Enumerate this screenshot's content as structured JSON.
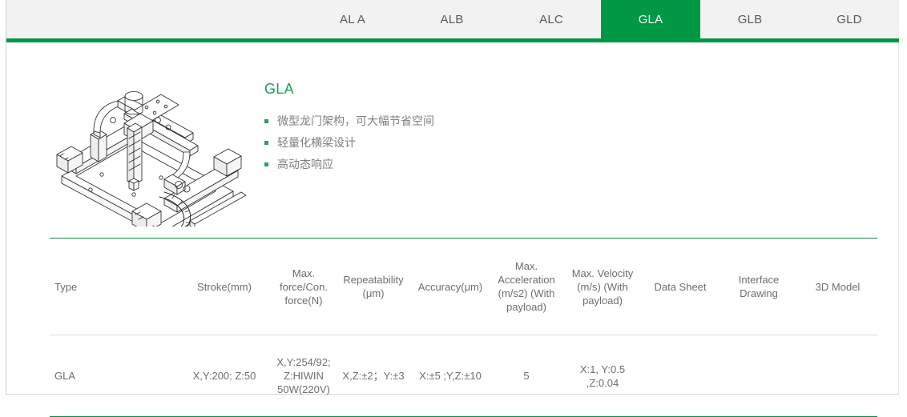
{
  "theme": {
    "accent_green": "#019845",
    "title_green": "#1aa059",
    "bullet_green": "#2aa15c",
    "tabbar_bg": "#f2f2f2",
    "text_gray": "#6e6e6e"
  },
  "tabs": [
    {
      "label": "AL A",
      "active": false
    },
    {
      "label": "ALB",
      "active": false
    },
    {
      "label": "ALC",
      "active": false
    },
    {
      "label": "GLA",
      "active": true
    },
    {
      "label": "GLB",
      "active": false
    },
    {
      "label": "GLD",
      "active": false
    }
  ],
  "product": {
    "image_alt": "gantry-robot-line-drawing",
    "title": "GLA",
    "features": [
      "微型龙门架构，可大幅节省空间",
      "轻量化横梁设计",
      "高动态响应"
    ]
  },
  "spec_table": {
    "headers": [
      "Type",
      "Stroke(mm)",
      "Max. force/Con. force(N)",
      "Repeatability (μm)",
      "Accuracy(μm)",
      "Max. Acceleration (m/s2) (With payload)",
      "Max. Velocity (m/s) (With payload)",
      "Data Sheet",
      "Interface Drawing",
      "3D Model"
    ],
    "header_lines": [
      [
        "Type"
      ],
      [
        "Stroke(mm)"
      ],
      [
        "Max.",
        "force/Con.",
        "force(N)"
      ],
      [
        "Repeatability",
        "(μm)"
      ],
      [
        "Accuracy(μm)"
      ],
      [
        "Max.",
        "Acceleration",
        "(m/s2) (With",
        "payload)"
      ],
      [
        "Max. Velocity",
        "(m/s) (With",
        "payload)"
      ],
      [
        "Data Sheet"
      ],
      [
        "Interface",
        "Drawing"
      ],
      [
        "3D Model"
      ]
    ],
    "rows": [
      {
        "type": "GLA",
        "stroke": "X,Y:200; Z:50",
        "max_force_lines": [
          "X,Y:254/92;",
          "Z:HIWIN",
          "50W(220V)"
        ],
        "repeatability": "X,Z:±2；Y:±3",
        "accuracy": "X:±5 ;Y,Z:±10",
        "max_acceleration": "5",
        "max_velocity_lines": [
          "X:1, Y:0.5",
          ",Z:0.04"
        ],
        "data_sheet": "",
        "interface_drawing": "",
        "model_3d": ""
      }
    ]
  }
}
